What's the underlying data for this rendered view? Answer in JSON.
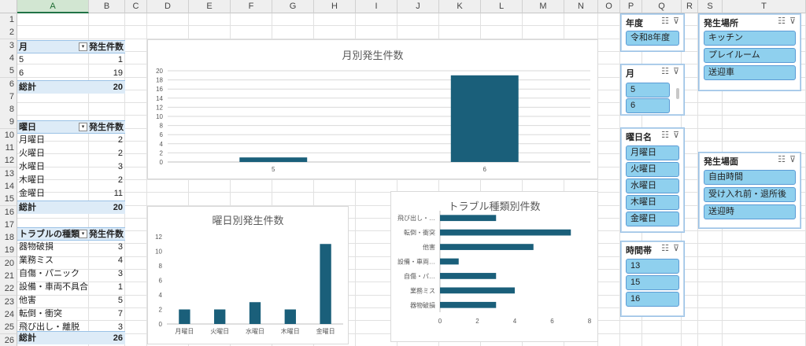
{
  "columns": [
    "A",
    "B",
    "C",
    "D",
    "E",
    "F",
    "G",
    "H",
    "I",
    "J",
    "K",
    "L",
    "M",
    "N",
    "O",
    "P",
    "Q",
    "R",
    "S",
    "T"
  ],
  "rows": [
    "1",
    "2",
    "3",
    "4",
    "5",
    "6",
    "7",
    "8",
    "9",
    "10",
    "11",
    "12",
    "13",
    "14",
    "15",
    "16",
    "17",
    "18",
    "19",
    "20",
    "21",
    "22",
    "23",
    "24",
    "25",
    "26"
  ],
  "pivot_month": {
    "header_label": "月",
    "header_value": "発生件数",
    "rows": [
      {
        "label": "5",
        "value": "1"
      },
      {
        "label": "6",
        "value": "19"
      }
    ],
    "total_label": "総計",
    "total_value": "20"
  },
  "pivot_weekday": {
    "header_label": "曜日",
    "header_value": "発生件数",
    "rows": [
      {
        "label": "月曜日",
        "value": "2"
      },
      {
        "label": "火曜日",
        "value": "2"
      },
      {
        "label": "水曜日",
        "value": "3"
      },
      {
        "label": "木曜日",
        "value": "2"
      },
      {
        "label": "金曜日",
        "value": "11"
      }
    ],
    "total_label": "総計",
    "total_value": "20"
  },
  "pivot_trouble": {
    "header_label": "トラブルの種類",
    "header_value": "発生件数",
    "rows": [
      {
        "label": "器物破損",
        "value": "3"
      },
      {
        "label": "業務ミス",
        "value": "4"
      },
      {
        "label": "自傷・パニック",
        "value": "3"
      },
      {
        "label": "設備・車両不具合",
        "value": "1"
      },
      {
        "label": "他害",
        "value": "5"
      },
      {
        "label": "転倒・衝突",
        "value": "7"
      },
      {
        "label": "飛び出し・離脱",
        "value": "3"
      }
    ],
    "total_label": "総計",
    "total_value": "26"
  },
  "chart_data": [
    {
      "type": "bar",
      "title": "月別発生件数",
      "categories": [
        "5",
        "6"
      ],
      "values": [
        1,
        19
      ],
      "ylim": [
        0,
        20
      ],
      "yticks": [
        "0",
        "2",
        "4",
        "6",
        "8",
        "10",
        "12",
        "14",
        "16",
        "18",
        "20"
      ],
      "grid": true,
      "color": "#1a5f7a"
    },
    {
      "type": "bar",
      "title": "曜日別発生件数",
      "categories": [
        "月曜日",
        "火曜日",
        "水曜日",
        "木曜日",
        "金曜日"
      ],
      "values": [
        2,
        2,
        3,
        2,
        11
      ],
      "ylim": [
        0,
        12
      ],
      "yticks": [
        "0",
        "2",
        "4",
        "6",
        "8",
        "10",
        "12"
      ],
      "grid": false,
      "color": "#1a5f7a"
    },
    {
      "type": "bar",
      "orientation": "horizontal",
      "title": "トラブル種類別件数",
      "categories": [
        "器物破損",
        "業務ミス",
        "自傷・パ…",
        "設備・車両…",
        "他害",
        "転倒・衝突",
        "飛び出し・…"
      ],
      "values": [
        3,
        4,
        3,
        1,
        5,
        7,
        3
      ],
      "xlim": [
        0,
        8
      ],
      "xticks": [
        "0",
        "2",
        "4",
        "6",
        "8"
      ],
      "grid": false,
      "color": "#1a5f7a"
    }
  ],
  "slicers": {
    "year": {
      "title": "年度",
      "items": [
        "令和8年度"
      ]
    },
    "month": {
      "title": "月",
      "items": [
        "5",
        "6"
      ]
    },
    "weekday": {
      "title": "曜日名",
      "items": [
        "月曜日",
        "火曜日",
        "水曜日",
        "木曜日",
        "金曜日"
      ]
    },
    "time": {
      "title": "時間帯",
      "items": [
        "13",
        "15",
        "16"
      ]
    },
    "place": {
      "title": "発生場所",
      "items": [
        "キッチン",
        "プレイルーム",
        "送迎車"
      ]
    },
    "scene": {
      "title": "発生場面",
      "items": [
        "自由時間",
        "受け入れ前・退所後",
        "送迎時"
      ]
    }
  },
  "icons": {
    "multi_select": "multi-select-icon",
    "clear_filter": "clear-filter-icon"
  },
  "colors": {
    "bar": "#1a5f7a",
    "slicer_item": "#8fd0ee",
    "pivot_header": "#ddebf7"
  }
}
